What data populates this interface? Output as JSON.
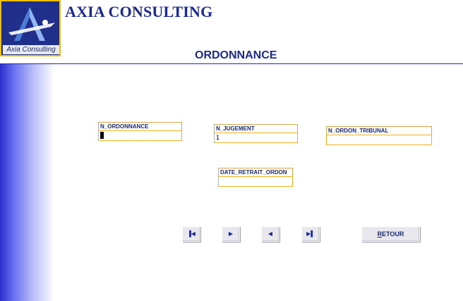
{
  "header": {
    "company_name": "AXIA CONSULTING",
    "logo_caption": "Axia Consulting",
    "page_title": "ORDONNANCE"
  },
  "fields": {
    "n_ordonnance": {
      "label": "N_ORDONNANCE",
      "value": ""
    },
    "n_jugement": {
      "label": "N_JUGEMENT",
      "value": "1"
    },
    "n_ordon_tribunal": {
      "label": "N_ORDON_TRIBUNAL",
      "value": ""
    },
    "date_retrait_ordon": {
      "label": "DATE_RETRAIT_ORDON",
      "value": ""
    }
  },
  "navigation": {
    "first_icon": "first-record-icon",
    "next_icon": "next-record-icon",
    "previous_icon": "previous-record-icon",
    "last_icon": "last-record-icon"
  },
  "retour": {
    "mnemonic": "R",
    "rest": "ETOUR"
  },
  "colors": {
    "brand_blue": "#1a2a9a",
    "field_border": "#f0b020",
    "logo_border": "#f0c000"
  }
}
